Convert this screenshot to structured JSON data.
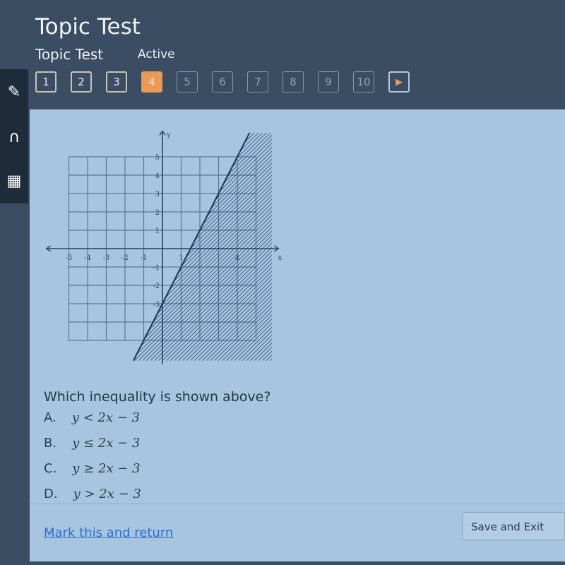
{
  "header": {
    "title": "Topic Test",
    "subtitle": "Topic Test",
    "status": "Active"
  },
  "nav": {
    "questions": [
      {
        "label": "1",
        "state": "answered"
      },
      {
        "label": "2",
        "state": "answered"
      },
      {
        "label": "3",
        "state": "answered"
      },
      {
        "label": "4",
        "state": "current"
      },
      {
        "label": "5",
        "state": "unvisited"
      },
      {
        "label": "6",
        "state": "unvisited"
      },
      {
        "label": "7",
        "state": "unvisited"
      },
      {
        "label": "8",
        "state": "unvisited"
      },
      {
        "label": "9",
        "state": "unvisited"
      },
      {
        "label": "10",
        "state": "unvisited"
      }
    ],
    "next_icon": "play-triangle-icon",
    "accent": "#e99a55"
  },
  "sidebar": {
    "tools": [
      "pencil-icon",
      "headphones-icon",
      "calculator-icon"
    ]
  },
  "graph": {
    "x_label": "x",
    "y_label": "y",
    "x_ticks": [
      "-5",
      "-4",
      "-3",
      "-2",
      "-1",
      "1",
      "4"
    ],
    "y_ticks": [
      "5",
      "4",
      "3",
      "2",
      "1",
      "-1",
      "-2",
      "-3"
    ],
    "x_range": [
      -5,
      5
    ],
    "y_range": [
      -5,
      5
    ],
    "line": {
      "slope": 2,
      "intercept": -3,
      "style": "solid"
    },
    "shading": "below-right"
  },
  "question": {
    "prompt": "Which inequality is shown above?",
    "choices": [
      {
        "letter": "A.",
        "text": "y < 2x − 3"
      },
      {
        "letter": "B.",
        "text": "y ≤ 2x − 3"
      },
      {
        "letter": "C.",
        "text": "y ≥ 2x − 3"
      },
      {
        "letter": "D.",
        "text": "y > 2x − 3"
      }
    ]
  },
  "footer": {
    "mark_link": "Mark this and return",
    "save_button": "Save and Exit"
  }
}
